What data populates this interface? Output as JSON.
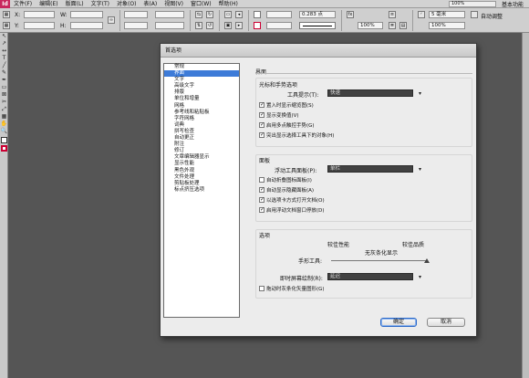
{
  "menubar": {
    "app_logo": "Id",
    "items": [
      "文件(F)",
      "编辑(E)",
      "版面(L)",
      "文字(T)",
      "对象(O)",
      "表(A)",
      "视图(V)",
      "窗口(W)",
      "帮助(H)"
    ],
    "zoom": "100%",
    "workspace": "基本功能"
  },
  "controlbar": {
    "x_label": "X:",
    "y_label": "Y:",
    "w_label": "W:",
    "h_label": "H:",
    "stroke_weight": "0.283 点",
    "size_value": "5 毫米",
    "percent_1": "100%",
    "percent_2": "100%",
    "auto_fit": "自动调整"
  },
  "tools": {
    "items": [
      "↖",
      "↗",
      "↔",
      "T",
      "╱",
      "✎",
      "✒",
      "▭",
      "⊠",
      "✂",
      "⤢",
      "▦",
      "✋",
      "🔍"
    ]
  },
  "dialog": {
    "title": "首选项",
    "categories": [
      "常规",
      "界面",
      "文字",
      "高级文字",
      "排版",
      "单位和增量",
      "网格",
      "参考线和粘贴板",
      "字符网格",
      "词典",
      "拼写检查",
      "自动更正",
      "附注",
      "修订",
      "文章编辑器显示",
      "显示性能",
      "黑色外观",
      "文件处理",
      "剪贴板处理",
      "标点挤压选项"
    ],
    "selected_index": 1,
    "section_title": "界面",
    "cursor_group": {
      "title": "光标和手势选项",
      "tooltips_label": "工具提示(T):",
      "tooltips_value": "快速",
      "checks": [
        {
          "label": "置入时显示缩览图(S)",
          "checked": true
        },
        {
          "label": "显示变换值(V)",
          "checked": true
        },
        {
          "label": "启用多点触控手势(G)",
          "checked": true
        },
        {
          "label": "突出显示选择工具下的对象(H)",
          "checked": true
        }
      ]
    },
    "panel_group": {
      "title": "面板",
      "floating_label": "浮动工具面板(P):",
      "floating_value": "单栏",
      "checks": [
        {
          "label": "自动折叠图标面板(I)",
          "checked": false
        },
        {
          "label": "自动显示隐藏面板(A)",
          "checked": true
        },
        {
          "label": "以选项卡方式打开文档(O)",
          "checked": true
        },
        {
          "label": "启用浮动文档窗口停放(D)",
          "checked": true
        }
      ]
    },
    "options_group": {
      "title": "选项",
      "slider_left": "较佳性能",
      "slider_right": "较佳品质",
      "slider_mid": "无灰条化显示",
      "hand_tool_label": "手形工具:",
      "hand_tool_level": 1.0,
      "live_redraw_label": "即时屏幕绘制(R):",
      "live_redraw_value": "延迟",
      "gray_check": {
        "label": "拖动时灰条化矢量图形(G)",
        "checked": false
      }
    },
    "ok_label": "确定",
    "cancel_label": "取消"
  },
  "colors": {
    "selection": "#3d7bd8",
    "dropdown_bg": "#414141",
    "workspace_bg": "#555555"
  }
}
